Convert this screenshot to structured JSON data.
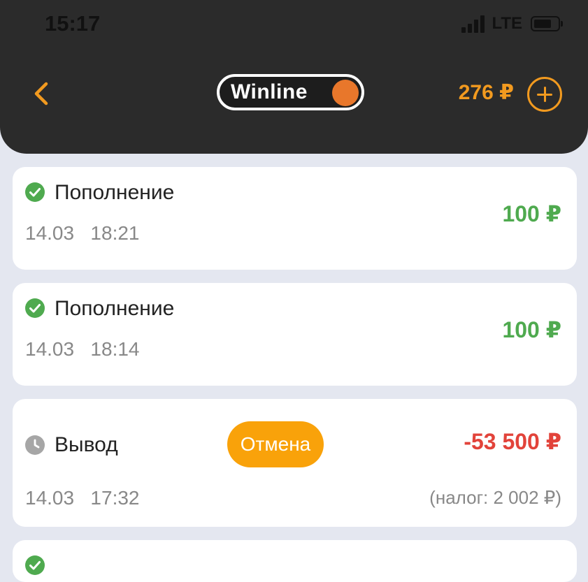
{
  "status_bar": {
    "time": "15:17",
    "network": "LTE"
  },
  "header": {
    "logo_text": "Winline",
    "balance": "276 ₽"
  },
  "transactions": [
    {
      "title": "Пополнение",
      "date": "14.03",
      "time": "18:21",
      "amount": "100 ₽",
      "status_icon": "check-circle-icon",
      "color": "#4faa4f"
    },
    {
      "title": "Пополнение",
      "date": "14.03",
      "time": "18:14",
      "amount": "100 ₽",
      "status_icon": "check-circle-icon",
      "color": "#4faa4f"
    },
    {
      "title": "Вывод",
      "badge": "Отмена",
      "date": "14.03",
      "time": "17:32",
      "amount": "-53 500 ₽",
      "tax": "(налог: 2 002 ₽)",
      "status_icon": "clock-icon",
      "color": "#e2433a"
    }
  ],
  "colors": {
    "accent": "#f29a1f",
    "badge": "#f9a20a",
    "header_bg": "#2b2b2b",
    "page_bg": "#e4e7f0"
  }
}
